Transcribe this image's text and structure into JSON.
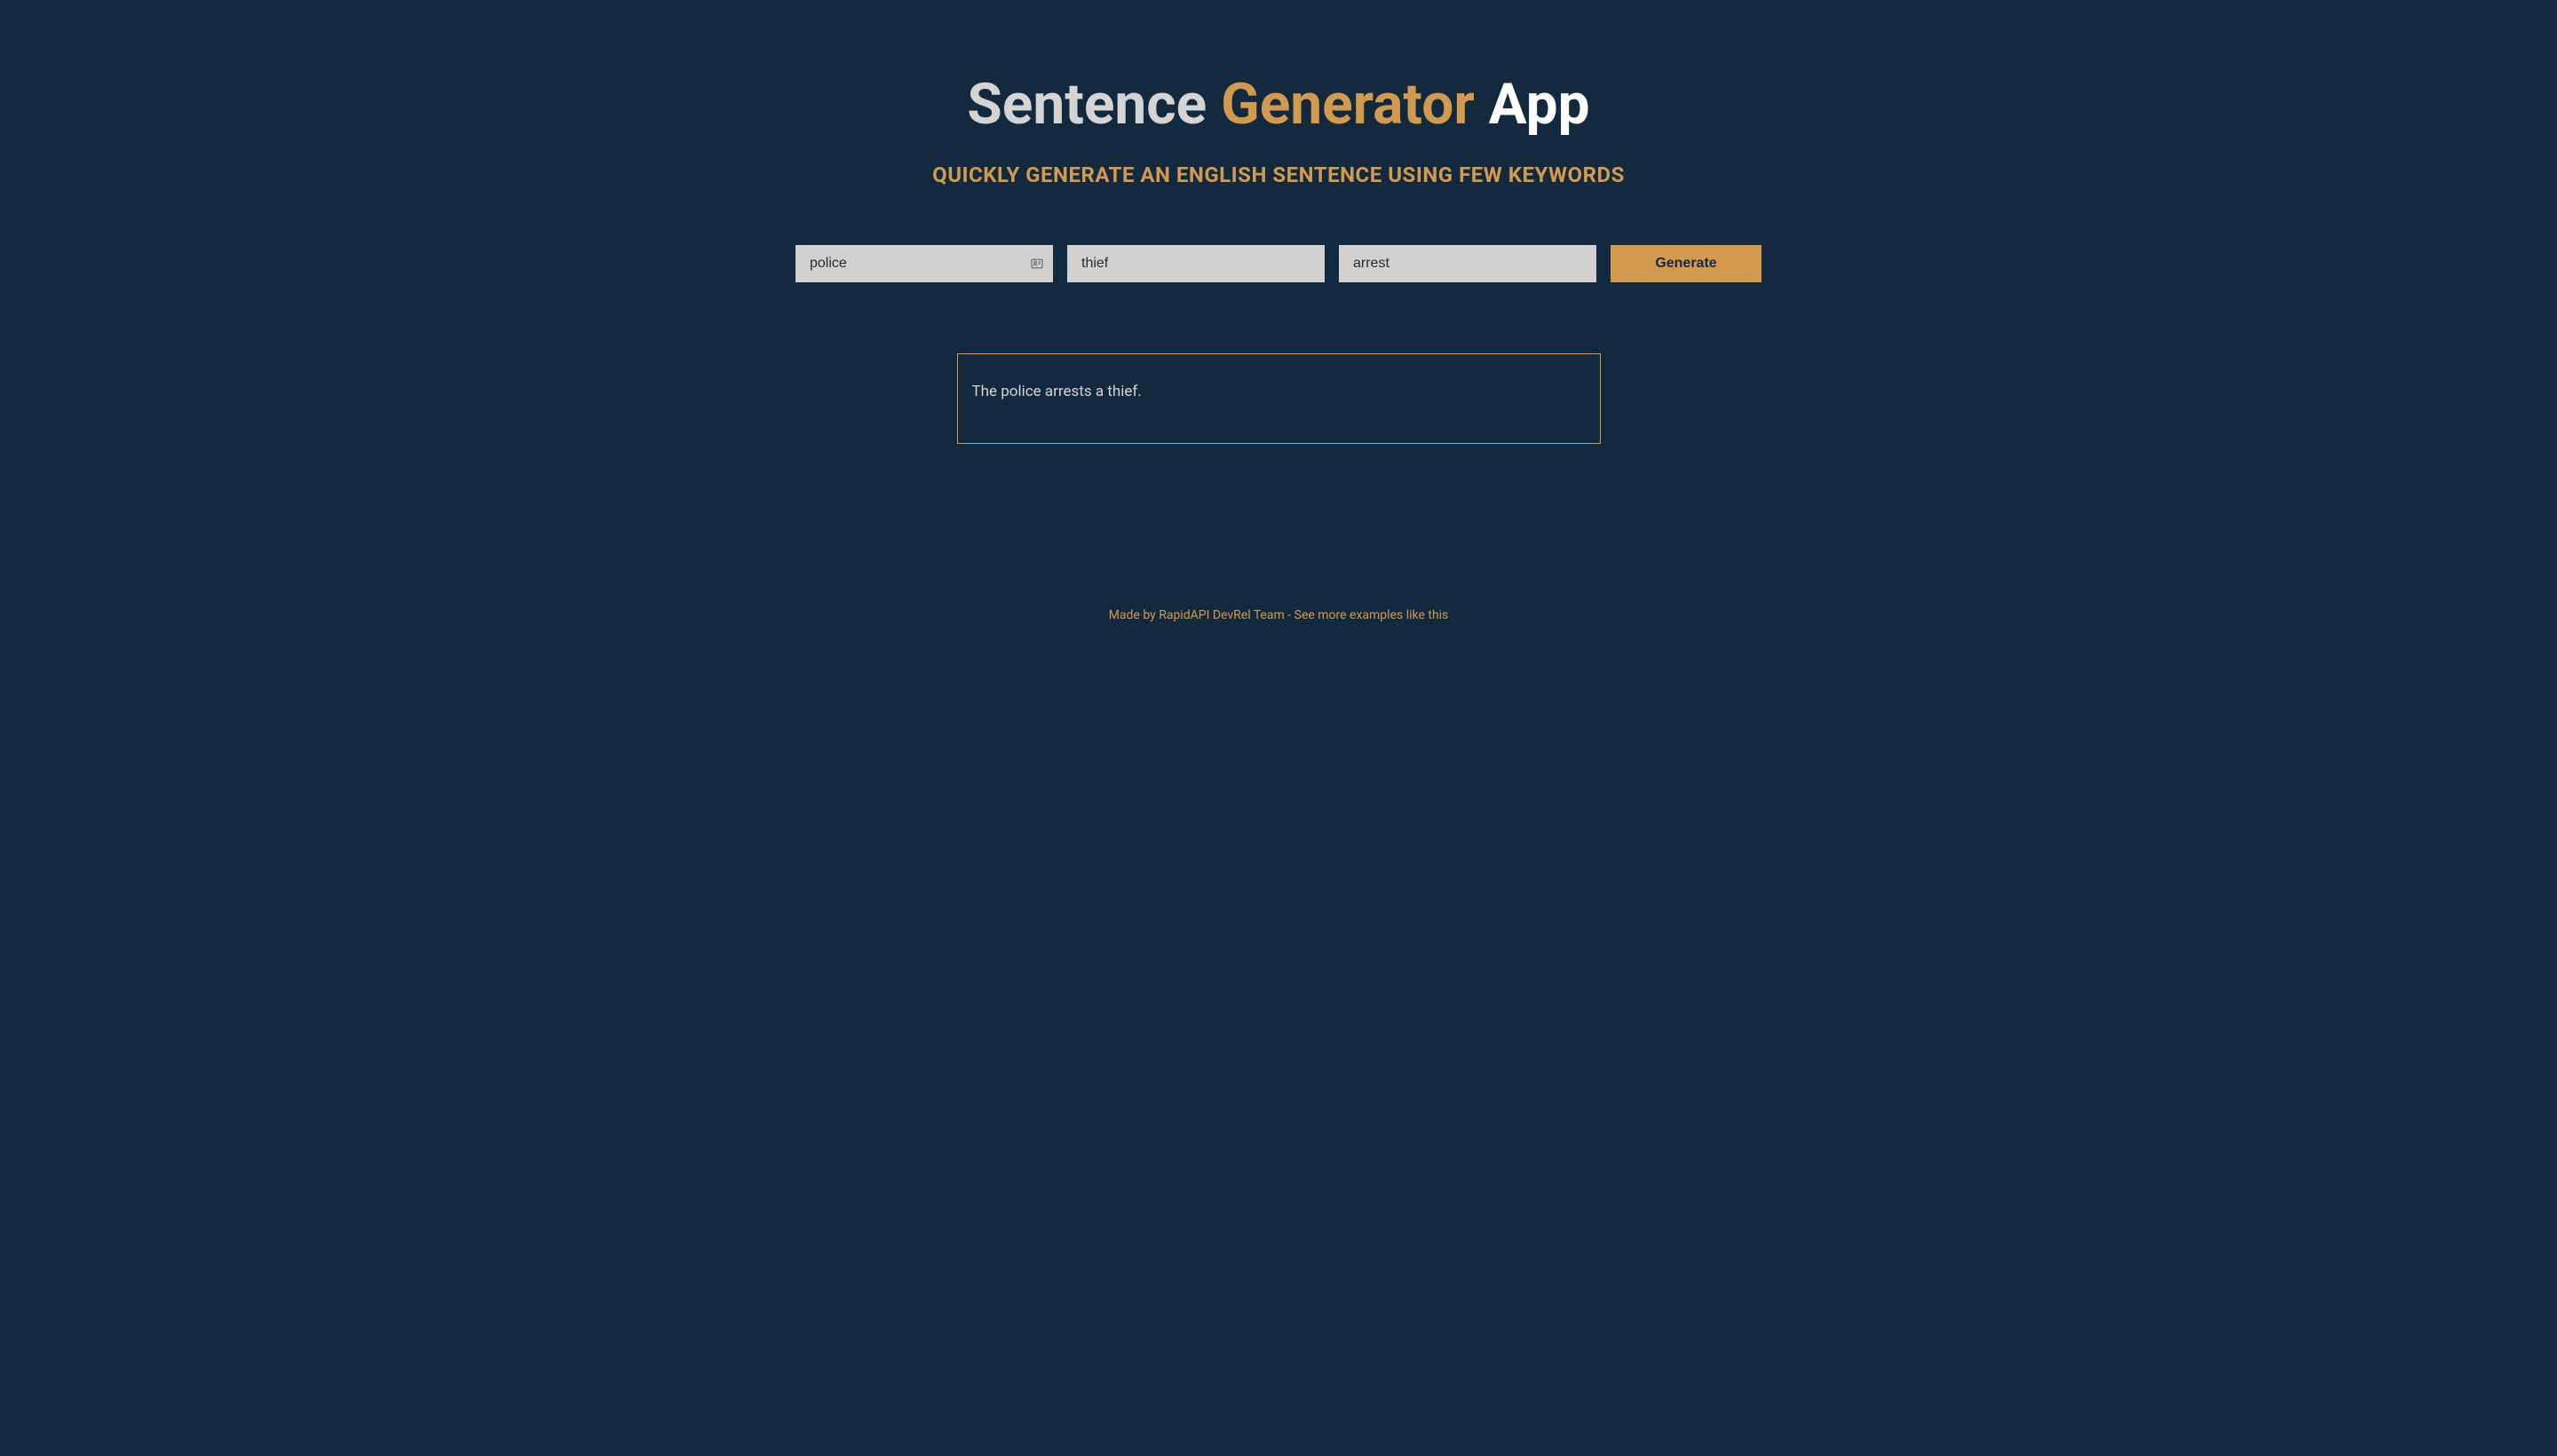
{
  "header": {
    "title_part_1": "Sentence ",
    "title_part_2": "Generator",
    "title_part_3": " App",
    "subtitle": "Quickly generate an English sentence using few keywords"
  },
  "inputs": {
    "keyword1_value": "police",
    "keyword2_value": "thief",
    "keyword3_value": "arrest",
    "generate_label": "Generate"
  },
  "result": {
    "text": "The police arrests a thief."
  },
  "footer": {
    "made_by": "Made by RapidAPI DevRel Team - ",
    "link_text": "See more examples like this"
  }
}
